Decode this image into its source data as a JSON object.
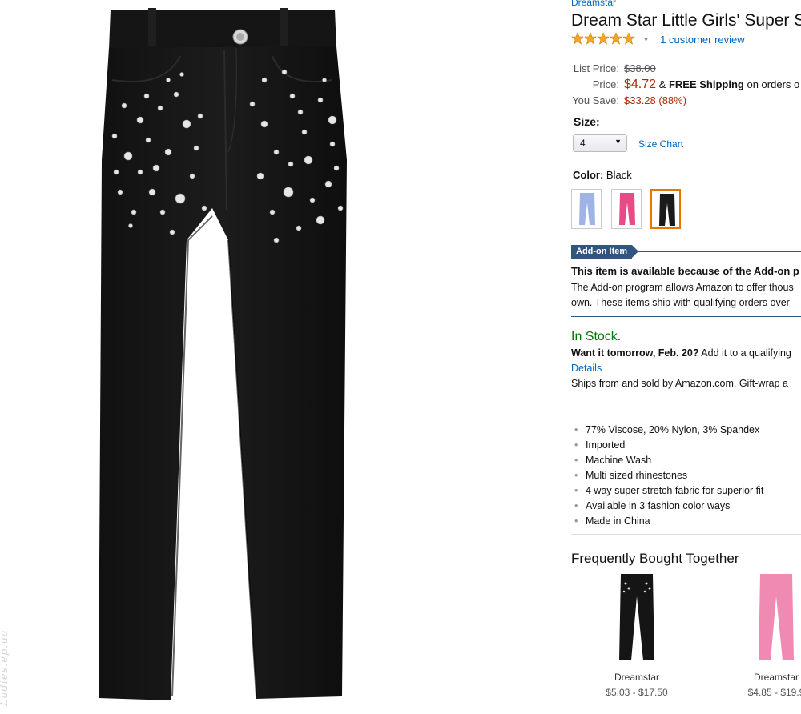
{
  "watermark": "Ladies.ep.ua",
  "product": {
    "brand": "Dreamstar",
    "title": "Dream Star Little Girls' Super S",
    "rating_stars": 5,
    "review_link": "1 customer review"
  },
  "pricing": {
    "list_label": "List Price:",
    "list_value": "$38.00",
    "price_label": "Price:",
    "price_value": "$4.72",
    "price_amp": "&",
    "free_shipping": "FREE Shipping",
    "shipping_tail": "on orders o",
    "save_label": "You Save:",
    "save_value": "$33.28 (88%)"
  },
  "size": {
    "label": "Size:",
    "selected": "4",
    "chart_link": "Size Chart"
  },
  "color": {
    "label": "Color:",
    "selected": "Black",
    "swatches": [
      {
        "name": "blue",
        "hex": "#9fb3e6"
      },
      {
        "name": "pink",
        "hex": "#e84a86"
      },
      {
        "name": "black",
        "hex": "#1a1a1a"
      }
    ]
  },
  "addon": {
    "badge": "Add-on Item",
    "title": "This item is available because of the Add-on p",
    "line1": "The Add-on program allows Amazon to offer thous",
    "line2": "own. These items ship with qualifying orders over"
  },
  "availability": {
    "stock": "In Stock.",
    "want_bold": "Want it tomorrow, Feb. 20?",
    "want_rest": "Add it to a qualifying",
    "details": "Details",
    "ships": "Ships from and sold by Amazon.com. Gift-wrap a"
  },
  "features": [
    "77% Viscose, 20% Nylon, 3% Spandex",
    "Imported",
    "Machine Wash",
    "Multi sized rhinestones",
    "4 way super stretch fabric for superior fit",
    "Available in 3 fashion color ways",
    "Made in China"
  ],
  "fbt": {
    "title": "Frequently Bought Together",
    "items": [
      {
        "name": "Dreamstar",
        "range": "$5.03 - $17.50",
        "color": "#151515"
      },
      {
        "name": "Dreamstar",
        "range": "$4.85 - $19.9",
        "color": "#f08ab2"
      }
    ]
  },
  "colors": {
    "link": "#0066c0",
    "price": "#b12704",
    "instock": "#007600",
    "addon": "#31557e",
    "selected_border": "#e77600"
  }
}
